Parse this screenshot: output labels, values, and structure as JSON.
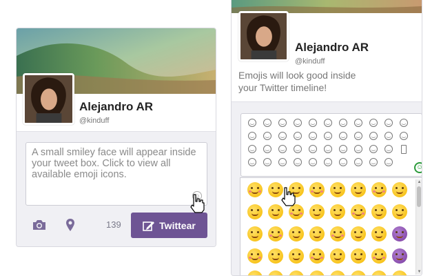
{
  "left_card": {
    "name": "Alejandro AR",
    "handle": "@kinduff",
    "tweet_box_placeholder": "A small smiley face will appear inside your tweet box. Click to view all available emoji icons.",
    "char_count": "139",
    "tweet_button_label": "Twittear",
    "icons": [
      "camera-icon",
      "location-icon",
      "compose-icon",
      "smiley-icon",
      "hand-cursor-icon"
    ]
  },
  "right_card": {
    "name": "Alejandro AR",
    "handle": "@kinduff",
    "intro_text": "Emojis will look good inside your Twitter timeline!",
    "mini_grid_rows": 4,
    "mini_grid_cols": 11,
    "big_grid_rows": 5,
    "big_grid_cols": 8,
    "icons": [
      "green-smiley-icon",
      "hand-cursor-icon",
      "scroll-up-icon",
      "scroll-down-icon"
    ]
  },
  "colors": {
    "accent": "#6e5494",
    "card_bg": "#f5f5f8",
    "emoji_yellow": "#f5b800",
    "green_smiley": "#2a9a3a"
  }
}
